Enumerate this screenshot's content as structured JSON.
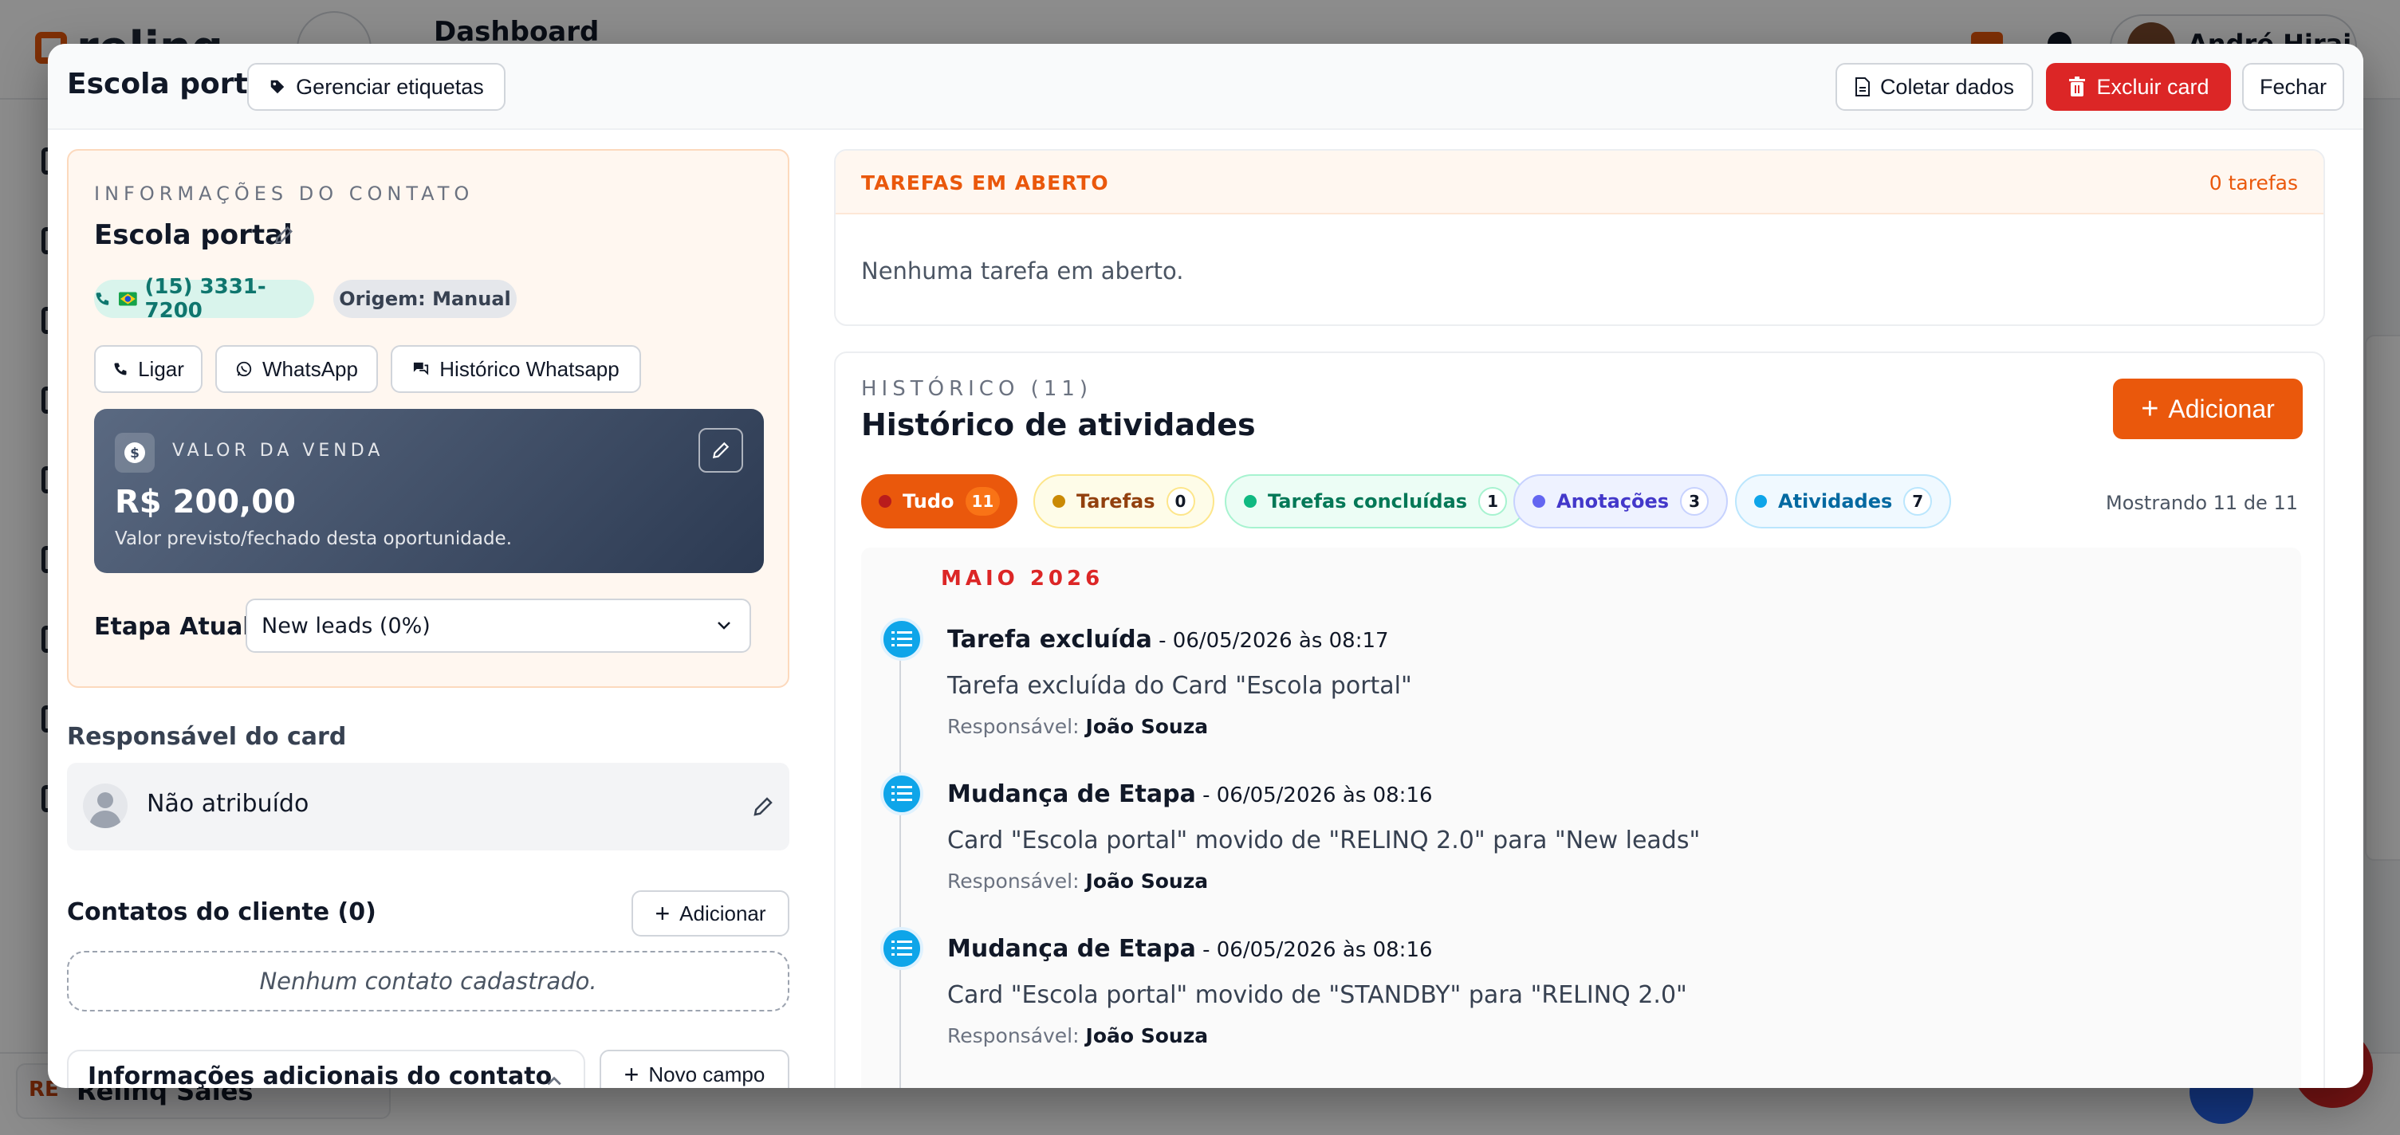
{
  "background": {
    "app_logo": "relinq",
    "page_title": "Dashboard",
    "user_name": "André Hirai",
    "workspace_badge": "RE",
    "workspace_name": "Relinq Sales"
  },
  "modal": {
    "title": "Escola portal",
    "manage_tags_label": "Gerenciar etiquetas",
    "collect_data_label": "Coletar dados",
    "delete_card_label": "Excluir card",
    "close_label": "Fechar"
  },
  "contact": {
    "section_label": "INFORMAÇÕES DO CONTATO",
    "name": "Escola portal",
    "phone": "(15) 3331-7200",
    "origin": "Origem: Manual",
    "actions": {
      "call": "Ligar",
      "whatsapp": "WhatsApp",
      "whatsapp_history": "Histórico Whatsapp"
    },
    "sale": {
      "label": "VALOR DA VENDA",
      "value": "R$ 200,00",
      "description": "Valor previsto/fechado desta oportunidade."
    },
    "stage_label": "Etapa Atual:",
    "stage_value": "New leads (0%)"
  },
  "responsible": {
    "title": "Responsável do card",
    "name": "Não atribuído"
  },
  "client_contacts": {
    "title": "Contatos do cliente (0)",
    "add_label": "Adicionar",
    "empty": "Nenhum contato cadastrado."
  },
  "additional_info": {
    "title": "Informações adicionais do contato",
    "new_field_label": "Novo campo"
  },
  "open_tasks": {
    "title": "TAREFAS EM ABERTO",
    "count": "0 tarefas",
    "empty": "Nenhuma tarefa em aberto."
  },
  "history": {
    "overline": "HISTÓRICO (11)",
    "title": "Histórico de atividades",
    "add_label": "Adicionar",
    "filters": [
      {
        "label": "Tudo",
        "count": "11"
      },
      {
        "label": "Tarefas",
        "count": "0"
      },
      {
        "label": "Tarefas concluídas",
        "count": "1"
      },
      {
        "label": "Anotações",
        "count": "3"
      },
      {
        "label": "Atividades",
        "count": "7"
      }
    ],
    "showing": "Mostrando 11 de 11",
    "month": "MAIO 2026",
    "responsible_prefix": "Responsável:",
    "entries": [
      {
        "title": "Tarefa excluída",
        "date": " - 06/05/2026 às 08:17",
        "description": "Tarefa excluída do Card \"Escola portal\"",
        "responsible": "João Souza"
      },
      {
        "title": "Mudança de Etapa",
        "date": " - 06/05/2026 às 08:16",
        "description": "Card \"Escola portal\" movido de \"RELINQ 2.0\" para \"New leads\"",
        "responsible": "João Souza"
      },
      {
        "title": "Mudança de Etapa",
        "date": " - 06/05/2026 às 08:16",
        "description": "Card \"Escola portal\" movido de \"STANDBY\" para \"RELINQ 2.0\"",
        "responsible": "João Souza"
      }
    ]
  },
  "colors": {
    "accent_orange": "#ea580c",
    "danger_red": "#dc2626",
    "timeline_blue": "#0ea5e9"
  }
}
